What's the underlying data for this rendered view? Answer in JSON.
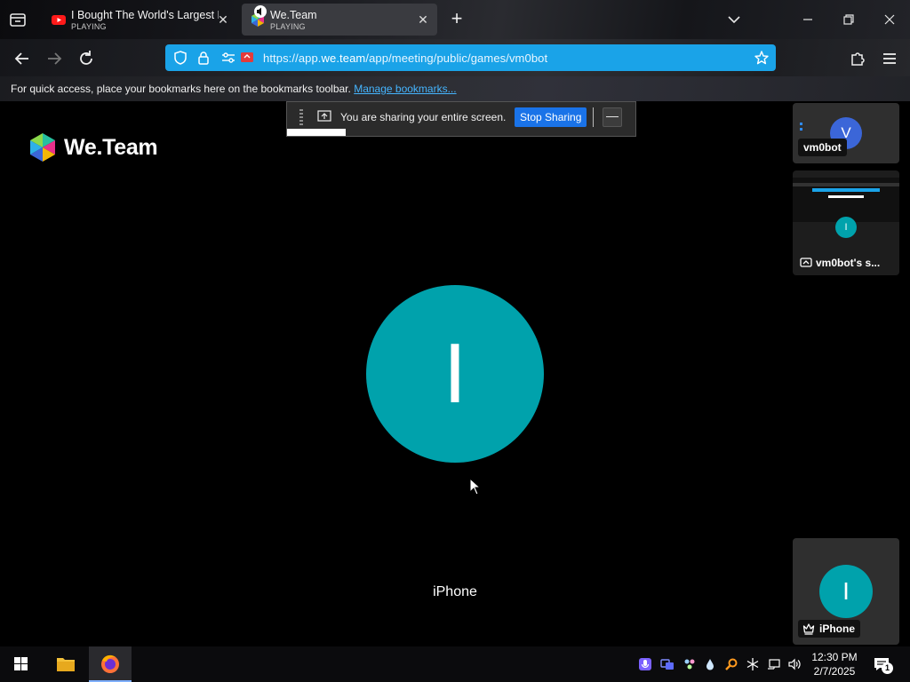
{
  "browser": {
    "tabs": [
      {
        "title": "I Bought The World's Largest M",
        "status": "PLAYING"
      },
      {
        "title": "We.Team",
        "status": "PLAYING"
      }
    ],
    "url": {
      "prefix": "https://app.",
      "domain": "we.team",
      "path": "/app/meeting/public/games/vm0bot"
    },
    "bookmarks_bar": {
      "message": "For quick access, place your bookmarks here on the bookmarks toolbar.",
      "link": "Manage bookmarks..."
    }
  },
  "meeting": {
    "logo_text": "We.Team",
    "share_bar": {
      "message": "You are sharing your entire screen.",
      "stop_label": "Stop Sharing",
      "minimize_label": "—"
    },
    "main": {
      "initial": "I",
      "name": "iPhone"
    },
    "participants": [
      {
        "initial": "V",
        "name": "vm0bot"
      },
      {
        "initial": "I",
        "name": "vm0bot's s..."
      },
      {
        "initial": "I",
        "name": "iPhone"
      }
    ]
  },
  "taskbar": {
    "time": "12:30 PM",
    "date": "2/7/2025",
    "notification_count": "1"
  },
  "colors": {
    "accent_url_bar": "#1aa3e8",
    "avatar_teal": "#00a2ac",
    "avatar_blue": "#3b66d8",
    "stop_button": "#1a73e8"
  }
}
